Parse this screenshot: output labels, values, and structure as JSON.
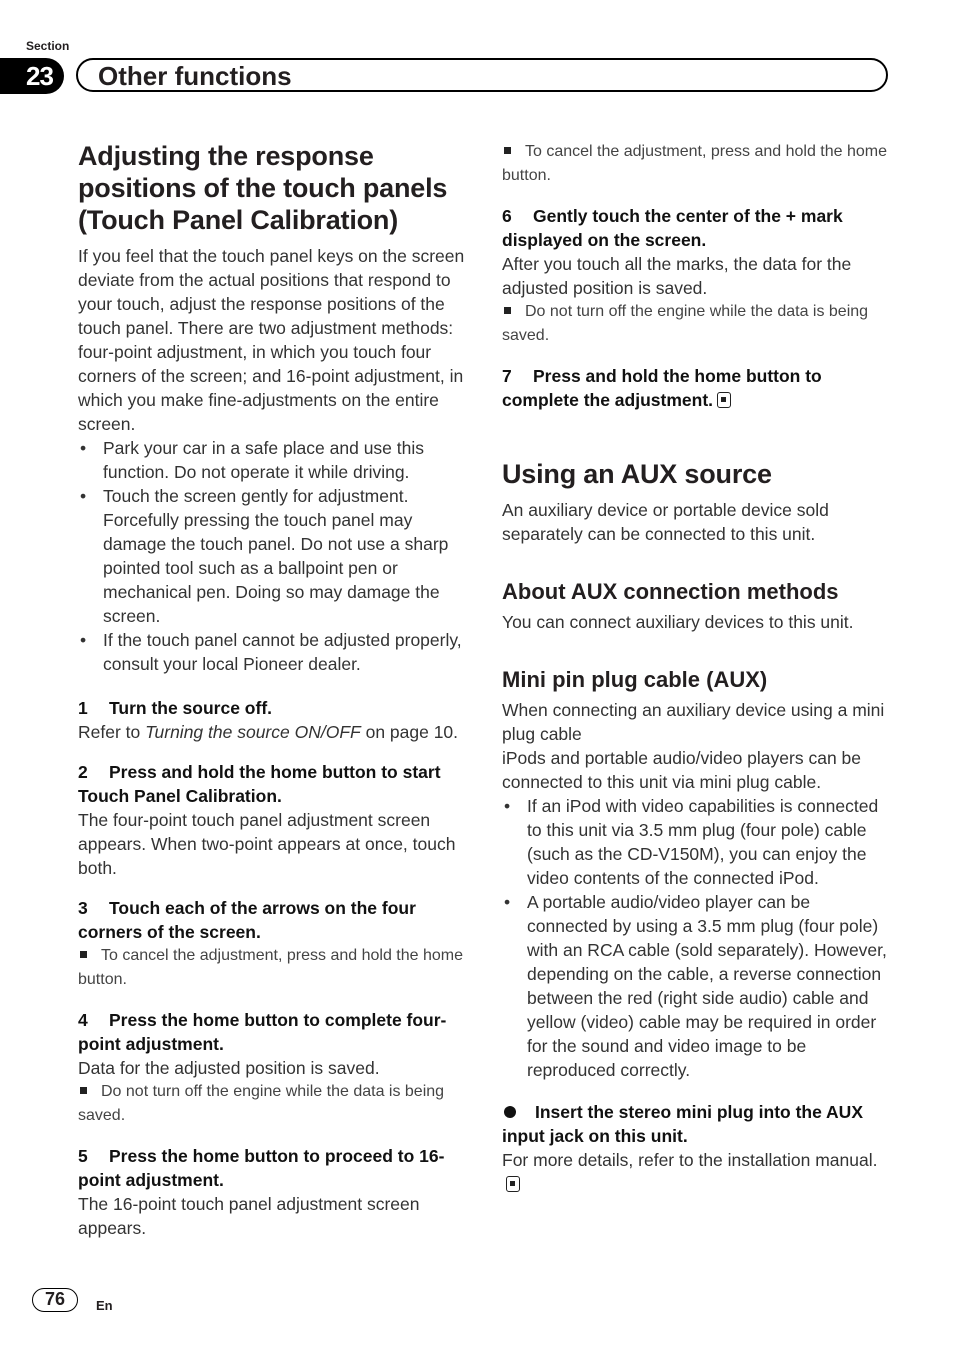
{
  "header": {
    "section_label": "Section",
    "section_number": "23",
    "section_title": "Other functions"
  },
  "left": {
    "title": "Adjusting the response positions of the touch panels (Touch Panel Calibration)",
    "intro": "If you feel that the touch panel keys on the screen deviate from the actual positions that respond to your touch, adjust the response positions of the touch panel. There are two adjustment methods: four-point adjustment, in which you touch four corners of the screen; and 16-point adjustment, in which you make fine-adjustments on the entire screen.",
    "bullets": [
      "Park your car in a safe place and use this function. Do not operate it while driving.",
      "Touch the screen gently for adjustment. Forcefully pressing the touch panel may damage the touch panel. Do not use a sharp pointed tool such as a ballpoint pen or mechanical pen. Doing so may damage the screen.",
      "If the touch panel cannot be adjusted properly, consult your local Pioneer dealer."
    ],
    "steps": [
      {
        "num": "1",
        "title": "Turn the source off.",
        "body_prefix": "Refer to ",
        "body_link": "Turning the source ON/OFF",
        "body_suffix": " on page 10."
      },
      {
        "num": "2",
        "title": "Press and hold the home button to start Touch Panel Calibration.",
        "body": "The four-point touch panel adjustment screen appears. When two-point appears at once, touch both."
      },
      {
        "num": "3",
        "title": "Touch each of the arrows on the four corners of the screen.",
        "note": "To cancel the adjustment, press and hold the home button."
      },
      {
        "num": "4",
        "title": "Press the home button to complete four-point adjustment.",
        "body": "Data for the adjusted position is saved.",
        "note": "Do not turn off the engine while the data is being saved."
      },
      {
        "num": "5",
        "title": "Press the home button to proceed to 16-point adjustment.",
        "body": "The 16-point touch panel adjustment screen appears."
      }
    ]
  },
  "right": {
    "top_note": "To cancel the adjustment, press and hold the home button.",
    "steps": [
      {
        "num": "6",
        "title": "Gently touch the center of the + mark displayed on the screen.",
        "body": "After you touch all the marks, the data for the adjusted position is saved.",
        "note": "Do not turn off the engine while the data is being saved."
      },
      {
        "num": "7",
        "title": "Press and hold the home button to complete the adjustment."
      }
    ],
    "aux_title": "Using an AUX source",
    "aux_intro": "An auxiliary device or portable device sold separately can be connected to this unit.",
    "methods_title": "About AUX connection methods",
    "methods_body": "You can connect auxiliary devices to this unit.",
    "mini_title": "Mini pin plug cable (AUX)",
    "mini_body1": "When connecting an auxiliary device using a mini plug cable",
    "mini_body2": "iPods and portable audio/video players can be connected to this unit via mini plug cable.",
    "mini_bullets": [
      "If an iPod with video capabilities is connected to this unit via 3.5 mm plug (four pole) cable (such as the CD-V150M), you can enjoy the video contents of the connected iPod.",
      "A portable audio/video player can be connected by using a 3.5 mm plug (four pole) with an RCA cable (sold separately). However, depending on the cable, a reverse connection between the red (right side audio) cable and yellow (video) cable may be required in order for the sound and video image to be reproduced correctly."
    ],
    "insert_title": "Insert the stereo mini plug into the AUX input jack on this unit.",
    "insert_body": "For more details, refer to the installation manual."
  },
  "footer": {
    "page_number": "76",
    "language": "En"
  }
}
